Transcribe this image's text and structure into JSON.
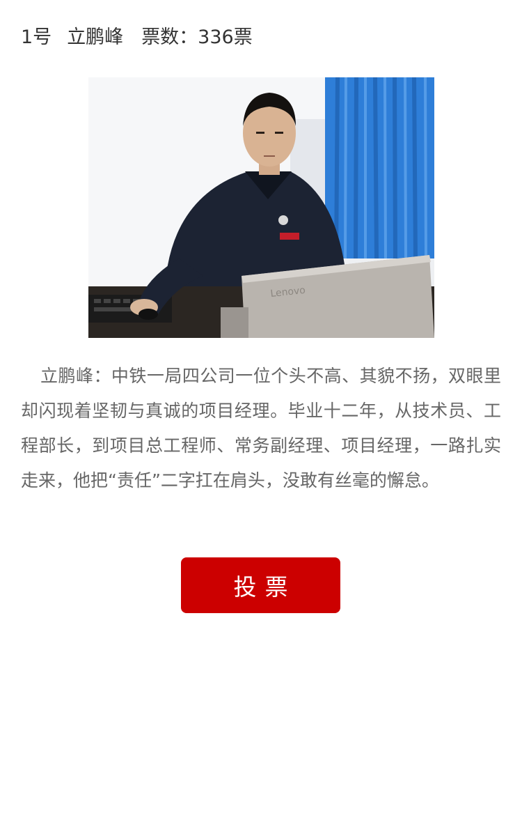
{
  "candidate": {
    "number": "1号",
    "name": "立鹏峰",
    "votes": "票数：336票"
  },
  "photo": {
    "laptop_brand": "Lenovo"
  },
  "description": "立鹏峰：中铁一局四公司一位个头不高、其貌不扬，双眼里却闪现着坚韧与真诚的项目经理。毕业十二年，从技术员、工程部长，到项目总工程师、常务副经理、项目经理，一路扎实走来，他把“责任”二字扛在肩头，没敢有丝毫的懈怠。",
  "vote_button": {
    "label": "投票"
  },
  "colors": {
    "accent": "#cc0000",
    "title_text": "#333333",
    "body_text": "#666666"
  }
}
